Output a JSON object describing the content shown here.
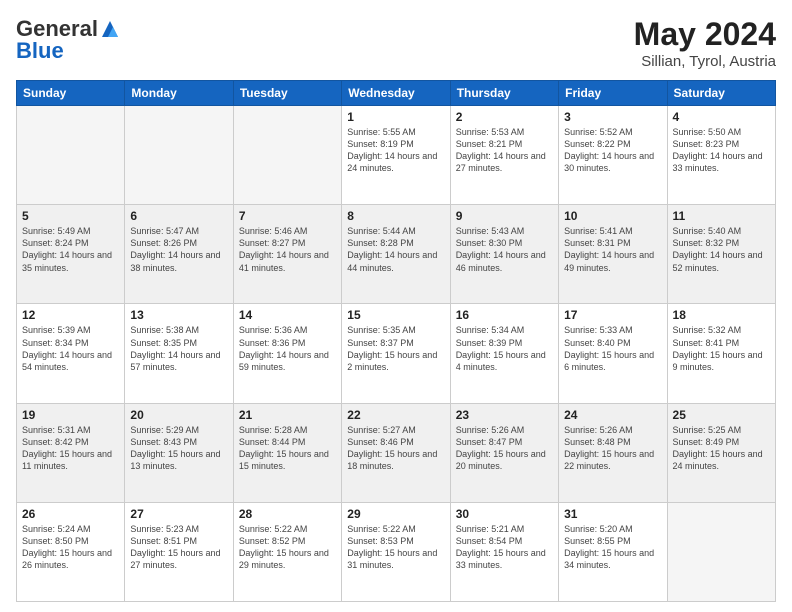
{
  "header": {
    "logo_general": "General",
    "logo_blue": "Blue",
    "month": "May 2024",
    "location": "Sillian, Tyrol, Austria"
  },
  "days_of_week": [
    "Sunday",
    "Monday",
    "Tuesday",
    "Wednesday",
    "Thursday",
    "Friday",
    "Saturday"
  ],
  "weeks": [
    {
      "days": [
        {
          "number": "",
          "info": ""
        },
        {
          "number": "",
          "info": ""
        },
        {
          "number": "",
          "info": ""
        },
        {
          "number": "1",
          "sunrise": "5:55 AM",
          "sunset": "8:19 PM",
          "daylight": "14 hours and 24 minutes."
        },
        {
          "number": "2",
          "sunrise": "5:53 AM",
          "sunset": "8:21 PM",
          "daylight": "14 hours and 27 minutes."
        },
        {
          "number": "3",
          "sunrise": "5:52 AM",
          "sunset": "8:22 PM",
          "daylight": "14 hours and 30 minutes."
        },
        {
          "number": "4",
          "sunrise": "5:50 AM",
          "sunset": "8:23 PM",
          "daylight": "14 hours and 33 minutes."
        }
      ]
    },
    {
      "days": [
        {
          "number": "5",
          "sunrise": "5:49 AM",
          "sunset": "8:24 PM",
          "daylight": "14 hours and 35 minutes."
        },
        {
          "number": "6",
          "sunrise": "5:47 AM",
          "sunset": "8:26 PM",
          "daylight": "14 hours and 38 minutes."
        },
        {
          "number": "7",
          "sunrise": "5:46 AM",
          "sunset": "8:27 PM",
          "daylight": "14 hours and 41 minutes."
        },
        {
          "number": "8",
          "sunrise": "5:44 AM",
          "sunset": "8:28 PM",
          "daylight": "14 hours and 44 minutes."
        },
        {
          "number": "9",
          "sunrise": "5:43 AM",
          "sunset": "8:30 PM",
          "daylight": "14 hours and 46 minutes."
        },
        {
          "number": "10",
          "sunrise": "5:41 AM",
          "sunset": "8:31 PM",
          "daylight": "14 hours and 49 minutes."
        },
        {
          "number": "11",
          "sunrise": "5:40 AM",
          "sunset": "8:32 PM",
          "daylight": "14 hours and 52 minutes."
        }
      ]
    },
    {
      "days": [
        {
          "number": "12",
          "sunrise": "5:39 AM",
          "sunset": "8:34 PM",
          "daylight": "14 hours and 54 minutes."
        },
        {
          "number": "13",
          "sunrise": "5:38 AM",
          "sunset": "8:35 PM",
          "daylight": "14 hours and 57 minutes."
        },
        {
          "number": "14",
          "sunrise": "5:36 AM",
          "sunset": "8:36 PM",
          "daylight": "14 hours and 59 minutes."
        },
        {
          "number": "15",
          "sunrise": "5:35 AM",
          "sunset": "8:37 PM",
          "daylight": "15 hours and 2 minutes."
        },
        {
          "number": "16",
          "sunrise": "5:34 AM",
          "sunset": "8:39 PM",
          "daylight": "15 hours and 4 minutes."
        },
        {
          "number": "17",
          "sunrise": "5:33 AM",
          "sunset": "8:40 PM",
          "daylight": "15 hours and 6 minutes."
        },
        {
          "number": "18",
          "sunrise": "5:32 AM",
          "sunset": "8:41 PM",
          "daylight": "15 hours and 9 minutes."
        }
      ]
    },
    {
      "days": [
        {
          "number": "19",
          "sunrise": "5:31 AM",
          "sunset": "8:42 PM",
          "daylight": "15 hours and 11 minutes."
        },
        {
          "number": "20",
          "sunrise": "5:29 AM",
          "sunset": "8:43 PM",
          "daylight": "15 hours and 13 minutes."
        },
        {
          "number": "21",
          "sunrise": "5:28 AM",
          "sunset": "8:44 PM",
          "daylight": "15 hours and 15 minutes."
        },
        {
          "number": "22",
          "sunrise": "5:27 AM",
          "sunset": "8:46 PM",
          "daylight": "15 hours and 18 minutes."
        },
        {
          "number": "23",
          "sunrise": "5:26 AM",
          "sunset": "8:47 PM",
          "daylight": "15 hours and 20 minutes."
        },
        {
          "number": "24",
          "sunrise": "5:26 AM",
          "sunset": "8:48 PM",
          "daylight": "15 hours and 22 minutes."
        },
        {
          "number": "25",
          "sunrise": "5:25 AM",
          "sunset": "8:49 PM",
          "daylight": "15 hours and 24 minutes."
        }
      ]
    },
    {
      "days": [
        {
          "number": "26",
          "sunrise": "5:24 AM",
          "sunset": "8:50 PM",
          "daylight": "15 hours and 26 minutes."
        },
        {
          "number": "27",
          "sunrise": "5:23 AM",
          "sunset": "8:51 PM",
          "daylight": "15 hours and 27 minutes."
        },
        {
          "number": "28",
          "sunrise": "5:22 AM",
          "sunset": "8:52 PM",
          "daylight": "15 hours and 29 minutes."
        },
        {
          "number": "29",
          "sunrise": "5:22 AM",
          "sunset": "8:53 PM",
          "daylight": "15 hours and 31 minutes."
        },
        {
          "number": "30",
          "sunrise": "5:21 AM",
          "sunset": "8:54 PM",
          "daylight": "15 hours and 33 minutes."
        },
        {
          "number": "31",
          "sunrise": "5:20 AM",
          "sunset": "8:55 PM",
          "daylight": "15 hours and 34 minutes."
        },
        {
          "number": "",
          "info": ""
        }
      ]
    }
  ]
}
